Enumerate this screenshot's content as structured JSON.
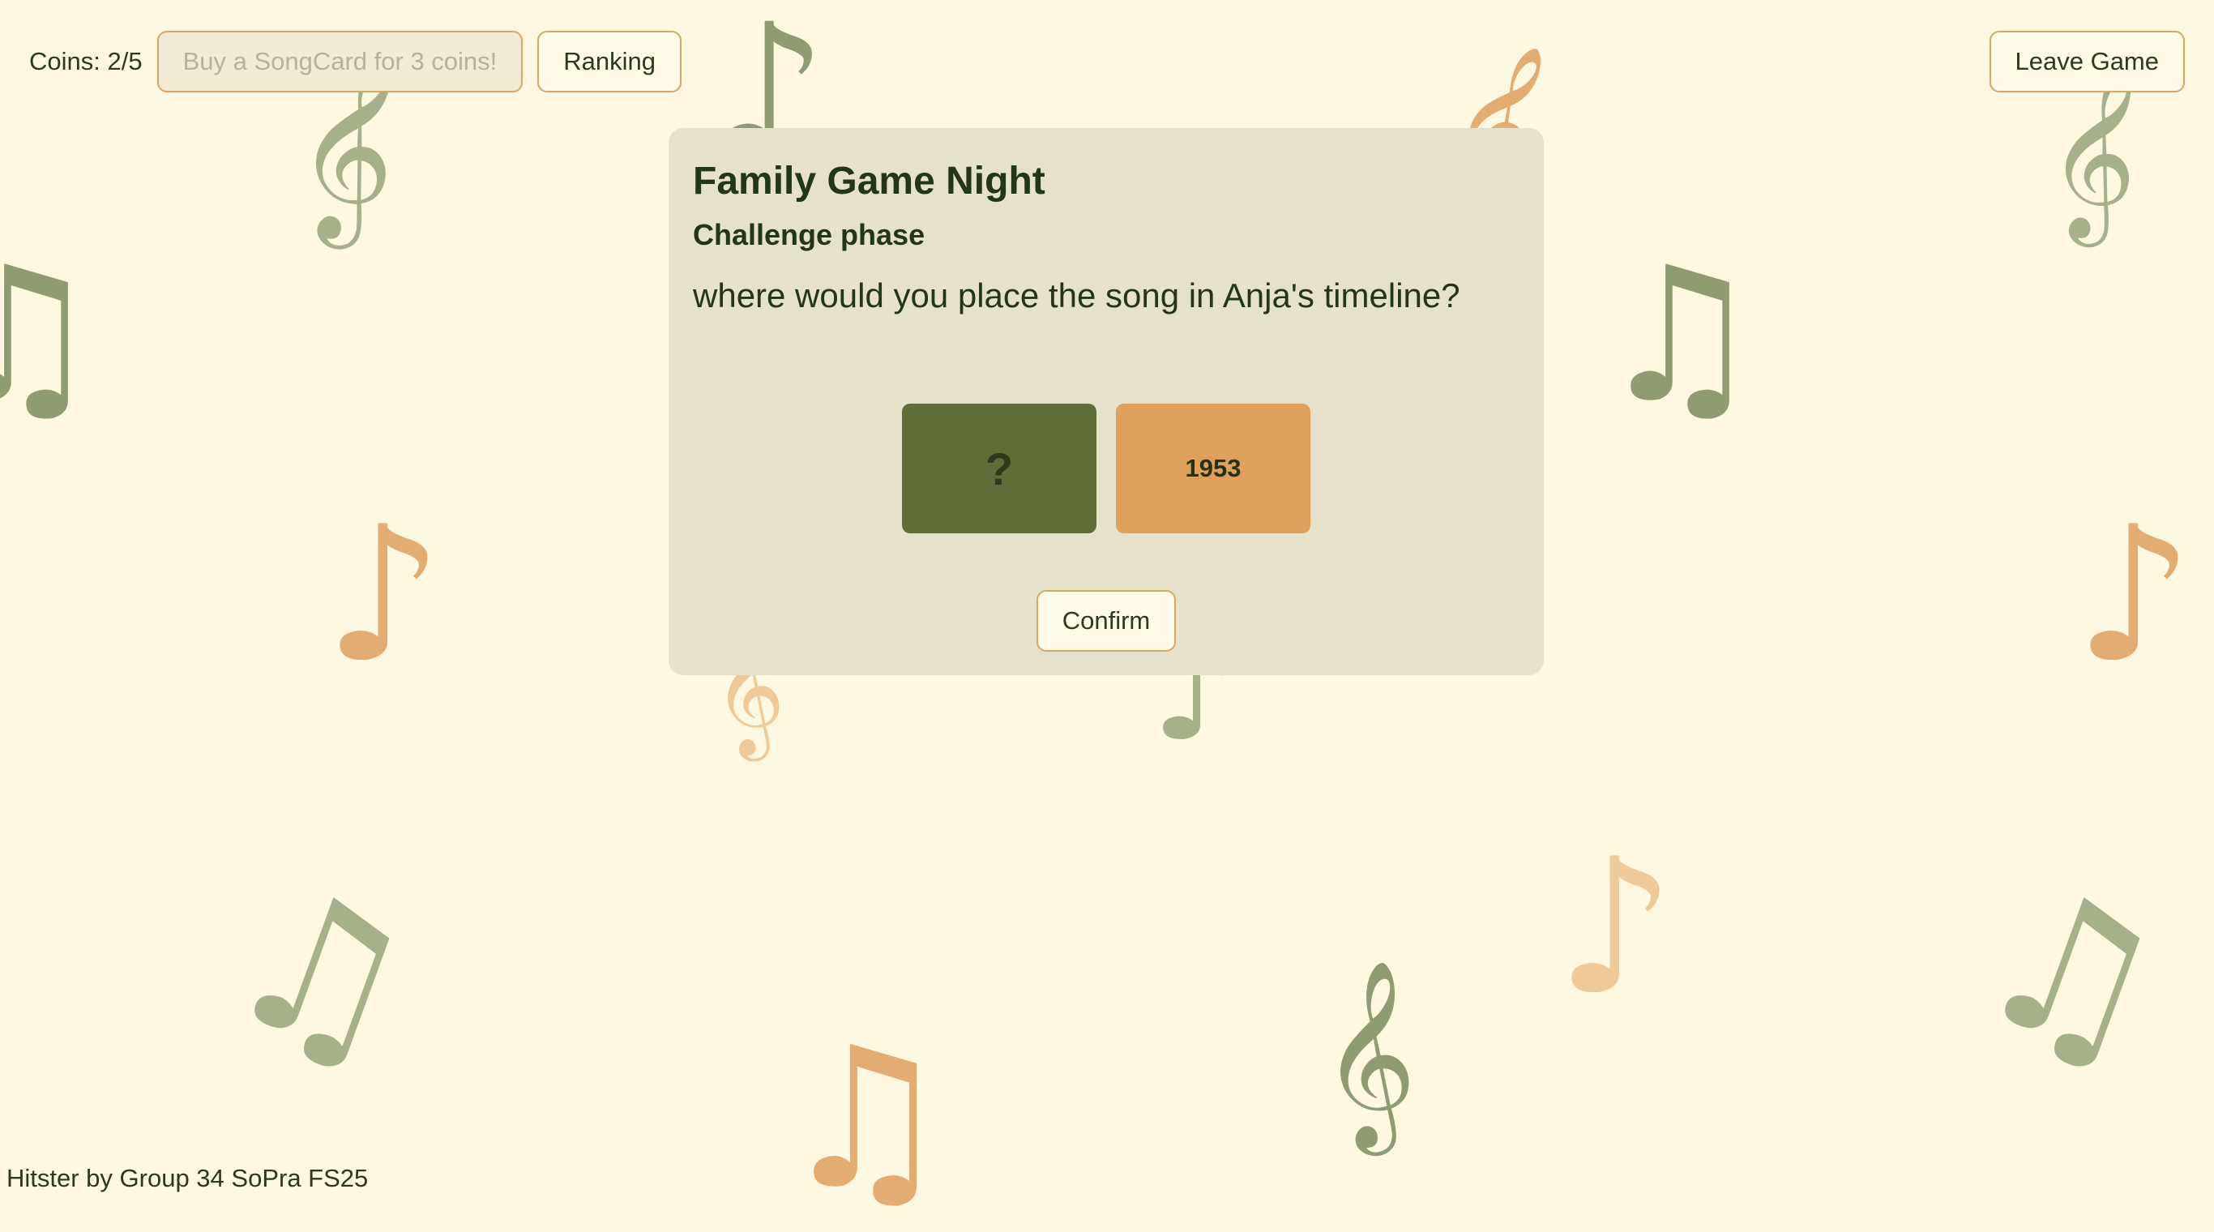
{
  "topbar": {
    "coins_text": "Coins: 2/5",
    "buy_label": "Buy a SongCard for 3 coins!",
    "ranking_label": "Ranking",
    "leave_label": "Leave Game"
  },
  "panel": {
    "title": "Family Game Night",
    "subtitle": "Challenge phase",
    "question": "where would you place the song in Anja's timeline?",
    "cards": [
      {
        "label": "?"
      },
      {
        "label": "1953"
      }
    ],
    "confirm_label": "Confirm"
  },
  "footer": {
    "text": "Hitster by Group 34 SoPra FS25"
  },
  "colors": {
    "background": "#fdf8df",
    "panel": "#e6e1ca",
    "card_unknown": "#5f6d38",
    "card_year": "#dea05c",
    "button_border": "#d8a766",
    "note_green": "#8f9b72",
    "note_orange": "#e2ac73"
  },
  "background_notes": [
    {
      "glyph": "𝄞",
      "icon": "treble-clef-icon"
    },
    {
      "glyph": "♪",
      "icon": "eighth-note-icon"
    },
    {
      "glyph": "♫",
      "icon": "beamed-notes-icon"
    }
  ]
}
